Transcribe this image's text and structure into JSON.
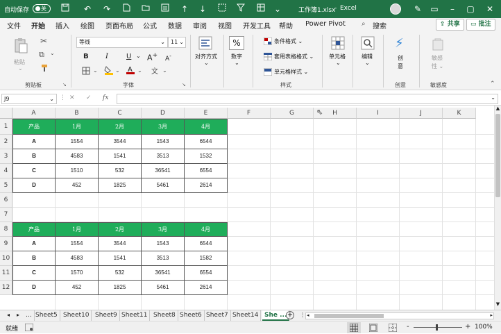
{
  "titlebar": {
    "autosave_label": "自动保存",
    "autosave_state": "关",
    "filename": "工作簿1.xlsx",
    "separator": "-",
    "app_name": "Excel",
    "color": "#217346"
  },
  "menu": {
    "items": [
      "文件",
      "开始",
      "插入",
      "绘图",
      "页面布局",
      "公式",
      "数据",
      "审阅",
      "视图",
      "开发工具",
      "帮助",
      "Power Pivot"
    ],
    "active": "开始",
    "search": "搜索",
    "share": "共享",
    "comment": "批注"
  },
  "ribbon": {
    "clipboard": {
      "paste": "粘贴",
      "label": "剪贴板"
    },
    "font": {
      "name": "等线",
      "size": "11",
      "bold": "B",
      "italic": "I",
      "underline": "U",
      "label": "字体"
    },
    "alignment": {
      "label": "对齐方式"
    },
    "number": {
      "label": "数字",
      "symbol": "%"
    },
    "styles": {
      "conditional": "条件格式",
      "table": "套用表格格式",
      "cell": "单元格样式",
      "label": "样式"
    },
    "cells": {
      "label": "单元格"
    },
    "editing": {
      "label": "编辑"
    },
    "ideas": {
      "label": "创意",
      "btn": "创\n意"
    },
    "sensitivity": {
      "label": "敏感度",
      "btn": "敏感\n性"
    }
  },
  "formula_bar": {
    "name_box": "J9",
    "fx": "fx",
    "value": ""
  },
  "columns": [
    "A",
    "B",
    "C",
    "D",
    "E",
    "F",
    "G",
    "H",
    "I",
    "J",
    "K"
  ],
  "rows": [
    "1",
    "2",
    "3",
    "4",
    "5",
    "6",
    "7",
    "8",
    "9",
    "10",
    "11",
    "12"
  ],
  "table1": {
    "headers": [
      "产品",
      "1月",
      "2月",
      "3月",
      "4月"
    ],
    "rows": [
      [
        "A",
        "1554",
        "3544",
        "1543",
        "6544"
      ],
      [
        "B",
        "4583",
        "1541",
        "3513",
        "1532"
      ],
      [
        "C",
        "1510",
        "532",
        "36541",
        "6554"
      ],
      [
        "D",
        "452",
        "1825",
        "5461",
        "2614"
      ]
    ]
  },
  "table2": {
    "headers": [
      "产品",
      "1月",
      "2月",
      "3月",
      "4月"
    ],
    "rows": [
      [
        "A",
        "1554",
        "3544",
        "1543",
        "6544"
      ],
      [
        "B",
        "4583",
        "1541",
        "3513",
        "1582"
      ],
      [
        "C",
        "1570",
        "532",
        "36541",
        "6554"
      ],
      [
        "D",
        "452",
        "1825",
        "5461",
        "2614"
      ]
    ],
    "header_color": "#1fad5a"
  },
  "sheets": {
    "ellipsis": "...",
    "tabs": [
      "Sheet5",
      "Sheet10",
      "Sheet9",
      "Sheet11",
      "Sheet8",
      "Sheet6",
      "Sheet7",
      "Sheet14",
      "She ..."
    ],
    "active": "She ..."
  },
  "status": {
    "mode": "就绪",
    "zoom": "100%",
    "minus": "-",
    "plus": "+"
  }
}
